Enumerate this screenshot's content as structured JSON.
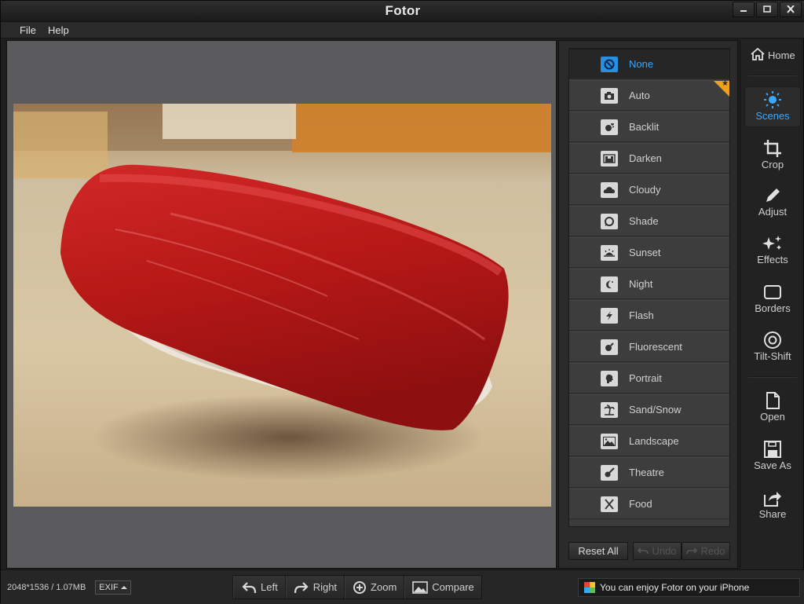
{
  "window": {
    "title": "Fotor",
    "controls": [
      {
        "name": "minimize-button",
        "icon": "minimize-icon"
      },
      {
        "name": "maximize-button",
        "icon": "maximize-icon"
      },
      {
        "name": "close-button",
        "icon": "close-icon"
      }
    ]
  },
  "menu": {
    "file": "File",
    "help": "Help"
  },
  "scenes": {
    "items": [
      {
        "label": "None",
        "icon": "none-icon",
        "selected": true
      },
      {
        "label": "Auto",
        "icon": "camera-icon",
        "badge": "star-badge"
      },
      {
        "label": "Backlit",
        "icon": "backlit-icon"
      },
      {
        "label": "Darken",
        "icon": "darken-icon"
      },
      {
        "label": "Cloudy",
        "icon": "cloud-icon"
      },
      {
        "label": "Shade",
        "icon": "shade-icon"
      },
      {
        "label": "Sunset",
        "icon": "sunset-icon"
      },
      {
        "label": "Night",
        "icon": "moon-icon"
      },
      {
        "label": "Flash",
        "icon": "flash-icon"
      },
      {
        "label": "Fluorescent",
        "icon": "bulb-icon"
      },
      {
        "label": "Portrait",
        "icon": "portrait-icon"
      },
      {
        "label": "Sand/Snow",
        "icon": "palm-icon"
      },
      {
        "label": "Landscape",
        "icon": "mountain-icon"
      },
      {
        "label": "Theatre",
        "icon": "guitar-icon"
      },
      {
        "label": "Food",
        "icon": "cutlery-icon"
      }
    ],
    "reset_label": "Reset All",
    "undo_label": "Undo",
    "redo_label": "Redo"
  },
  "toolbar": {
    "home": "Home",
    "scenes": "Scenes",
    "crop": "Crop",
    "adjust": "Adjust",
    "effects": "Effects",
    "borders": "Borders",
    "tiltshift": "Tilt-Shift",
    "open": "Open",
    "save_as": "Save As",
    "share": "Share"
  },
  "status": {
    "dimensions": "2048*1536 / 1.07MB",
    "exif_label": "EXIF",
    "tools": {
      "left": "Left",
      "right": "Right",
      "zoom": "Zoom",
      "compare": "Compare"
    },
    "promo": "You can enjoy Fotor on your iPhone"
  },
  "colors": {
    "accent": "#3aa7ff",
    "badge": "#f0a020"
  }
}
